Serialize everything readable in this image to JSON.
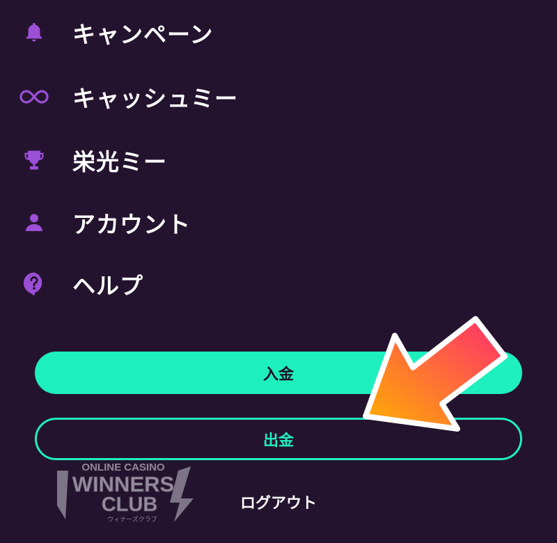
{
  "menu": {
    "items": [
      {
        "label": "キャンペーン",
        "icon": "bell-icon"
      },
      {
        "label": "キャッシュミー",
        "icon": "infinity-icon"
      },
      {
        "label": "栄光ミー",
        "icon": "trophy-icon"
      },
      {
        "label": "アカウント",
        "icon": "user-icon"
      },
      {
        "label": "ヘルプ",
        "icon": "help-icon"
      }
    ]
  },
  "actions": {
    "deposit_label": "入金",
    "withdraw_label": "出金",
    "logout_label": "ログアウト"
  },
  "watermark": {
    "line1": "ONLINE CASINO",
    "line2": "WINNERS",
    "line3": "CLUB",
    "line4": "ウィナーズクラブ"
  },
  "colors": {
    "background": "#24132e",
    "icon_purple": "#9b4fd6",
    "accent_teal": "#1eefbe",
    "arrow_start": "#ffb000",
    "arrow_end": "#ff2d6f"
  }
}
